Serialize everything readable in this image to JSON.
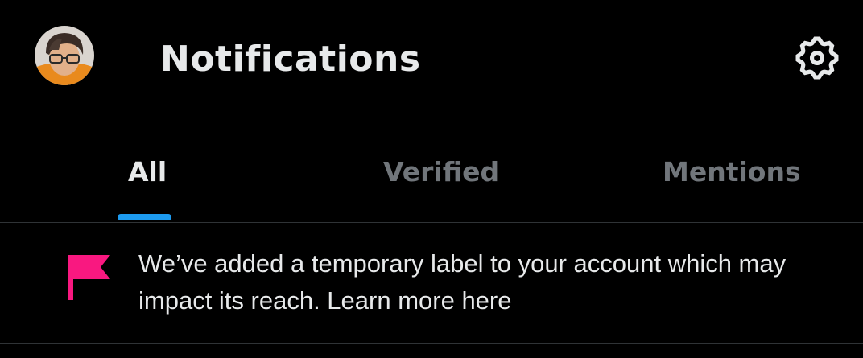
{
  "header": {
    "title": "Notifications",
    "avatar_icon": "user-avatar",
    "settings_icon": "gear-icon"
  },
  "tabs": [
    {
      "label": "All",
      "active": true
    },
    {
      "label": "Verified",
      "active": false
    },
    {
      "label": "Mentions",
      "active": false
    }
  ],
  "notice": {
    "icon": "flag-icon",
    "text": "We’ve added a temporary label to your account which may impact its reach. Learn more here"
  },
  "colors": {
    "background": "#000000",
    "text_primary": "#e7e9ea",
    "text_secondary": "#71767b",
    "accent": "#1d9bf0",
    "flag": "#f91880",
    "divider": "#2f3336"
  }
}
